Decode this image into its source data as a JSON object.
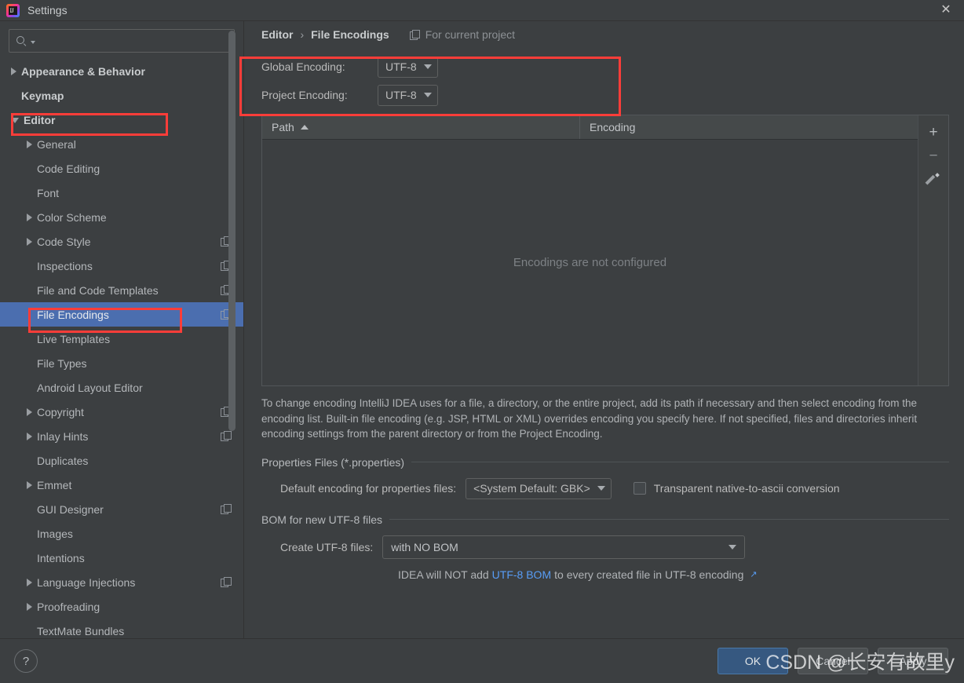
{
  "window": {
    "title": "Settings",
    "logo_icon": "intellij-idea-logo",
    "close_icon": "close-icon"
  },
  "sidebar": {
    "search": {
      "placeholder": "",
      "value": "",
      "icon": "search-icon"
    },
    "items": [
      {
        "label": "Appearance & Behavior",
        "indent": 0,
        "arrow": "collapsed",
        "bold": true,
        "copy": false,
        "selected": false
      },
      {
        "label": "Keymap",
        "indent": 0,
        "arrow": "none",
        "bold": true,
        "copy": false,
        "selected": false
      },
      {
        "label": "Editor",
        "indent": 0,
        "arrow": "expanded",
        "bold": true,
        "copy": false,
        "selected": false
      },
      {
        "label": "General",
        "indent": 1,
        "arrow": "collapsed",
        "bold": false,
        "copy": false,
        "selected": false
      },
      {
        "label": "Code Editing",
        "indent": 1,
        "arrow": "none",
        "bold": false,
        "copy": false,
        "selected": false
      },
      {
        "label": "Font",
        "indent": 1,
        "arrow": "none",
        "bold": false,
        "copy": false,
        "selected": false
      },
      {
        "label": "Color Scheme",
        "indent": 1,
        "arrow": "collapsed",
        "bold": false,
        "copy": false,
        "selected": false
      },
      {
        "label": "Code Style",
        "indent": 1,
        "arrow": "collapsed",
        "bold": false,
        "copy": true,
        "selected": false
      },
      {
        "label": "Inspections",
        "indent": 1,
        "arrow": "none",
        "bold": false,
        "copy": true,
        "selected": false
      },
      {
        "label": "File and Code Templates",
        "indent": 1,
        "arrow": "none",
        "bold": false,
        "copy": true,
        "selected": false
      },
      {
        "label": "File Encodings",
        "indent": 1,
        "arrow": "none",
        "bold": false,
        "copy": true,
        "selected": true
      },
      {
        "label": "Live Templates",
        "indent": 1,
        "arrow": "none",
        "bold": false,
        "copy": false,
        "selected": false
      },
      {
        "label": "File Types",
        "indent": 1,
        "arrow": "none",
        "bold": false,
        "copy": false,
        "selected": false
      },
      {
        "label": "Android Layout Editor",
        "indent": 1,
        "arrow": "none",
        "bold": false,
        "copy": false,
        "selected": false
      },
      {
        "label": "Copyright",
        "indent": 1,
        "arrow": "collapsed",
        "bold": false,
        "copy": true,
        "selected": false
      },
      {
        "label": "Inlay Hints",
        "indent": 1,
        "arrow": "collapsed",
        "bold": false,
        "copy": true,
        "selected": false
      },
      {
        "label": "Duplicates",
        "indent": 1,
        "arrow": "none",
        "bold": false,
        "copy": false,
        "selected": false
      },
      {
        "label": "Emmet",
        "indent": 1,
        "arrow": "collapsed",
        "bold": false,
        "copy": false,
        "selected": false
      },
      {
        "label": "GUI Designer",
        "indent": 1,
        "arrow": "none",
        "bold": false,
        "copy": true,
        "selected": false
      },
      {
        "label": "Images",
        "indent": 1,
        "arrow": "none",
        "bold": false,
        "copy": false,
        "selected": false
      },
      {
        "label": "Intentions",
        "indent": 1,
        "arrow": "none",
        "bold": false,
        "copy": false,
        "selected": false
      },
      {
        "label": "Language Injections",
        "indent": 1,
        "arrow": "collapsed",
        "bold": false,
        "copy": true,
        "selected": false
      },
      {
        "label": "Proofreading",
        "indent": 1,
        "arrow": "collapsed",
        "bold": false,
        "copy": false,
        "selected": false
      },
      {
        "label": "TextMate Bundles",
        "indent": 1,
        "arrow": "none",
        "bold": false,
        "copy": false,
        "selected": false
      }
    ]
  },
  "main": {
    "breadcrumb": {
      "root": "Editor",
      "separator": "›",
      "current": "File Encodings",
      "scope_note": "For current project",
      "scope_icon": "copy-icon"
    },
    "encoding_rows": [
      {
        "label": "Global Encoding:",
        "value": "UTF-8"
      },
      {
        "label": "Project Encoding:",
        "value": "UTF-8"
      }
    ],
    "table": {
      "columns": [
        "Path",
        "Encoding"
      ],
      "sort_column": "Path",
      "sort_direction": "ascending",
      "rows": [],
      "empty_message": "Encodings are not configured",
      "tools": [
        {
          "name": "add-row-button",
          "glyph": "+"
        },
        {
          "name": "remove-row-button",
          "glyph": "−"
        },
        {
          "name": "edit-row-button",
          "glyph": "pencil"
        }
      ]
    },
    "description": "To change encoding IntelliJ IDEA uses for a file, a directory, or the entire project, add its path if necessary and then select encoding from the encoding list. Built-in file encoding (e.g. JSP, HTML or XML) overrides encoding you specify here. If not specified, files and directories inherit encoding settings from the parent directory or from the Project Encoding.",
    "properties_section": {
      "title": "Properties Files (*.properties)",
      "default_encoding_label": "Default encoding for properties files:",
      "default_encoding_value": "<System Default: GBK>",
      "transparent_label": "Transparent native-to-ascii conversion",
      "transparent_checked": false
    },
    "bom_section": {
      "title": "BOM for new UTF-8 files",
      "create_label": "Create UTF-8 files:",
      "create_value": "with NO BOM",
      "hint_prefix": "IDEA will NOT add",
      "hint_link": "UTF-8 BOM",
      "hint_suffix": "to every created file in UTF-8 encoding",
      "hint_external_icon": "↗"
    }
  },
  "footer": {
    "help_label": "?",
    "ok_label": "OK",
    "cancel_label": "Cancel",
    "apply_label": "Apply"
  },
  "watermark": {
    "text": "CSDN @长安有故里y"
  },
  "annotations": {
    "color": "#fc3d39",
    "boxes": [
      "editor-tree-item",
      "file-encodings-tree-item",
      "encodings-panel"
    ]
  }
}
